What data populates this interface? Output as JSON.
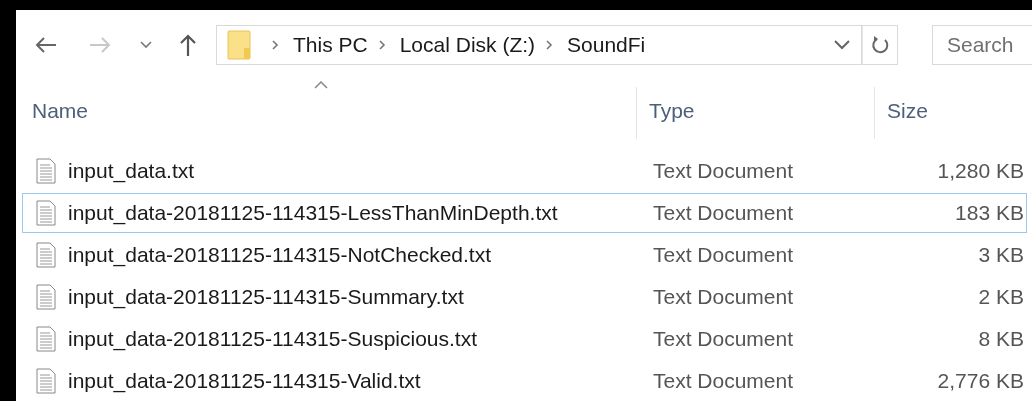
{
  "address_bar": {
    "segments": [
      "This PC",
      "Local Disk (Z:)",
      "SoundFi"
    ]
  },
  "search": {
    "placeholder": "Search"
  },
  "columns": [
    {
      "label": "Name",
      "sorted": true
    },
    {
      "label": "Type",
      "sorted": false
    },
    {
      "label": "Size",
      "sorted": false
    }
  ],
  "rows": [
    {
      "name": "input_data.txt",
      "type": "Text Document",
      "size": "1,280 KB",
      "focused": false
    },
    {
      "name": "input_data-20181125-114315-LessThanMinDepth.txt",
      "type": "Text Document",
      "size": "183 KB",
      "focused": true
    },
    {
      "name": "input_data-20181125-114315-NotChecked.txt",
      "type": "Text Document",
      "size": "3 KB",
      "focused": false
    },
    {
      "name": "input_data-20181125-114315-Summary.txt",
      "type": "Text Document",
      "size": "2 KB",
      "focused": false
    },
    {
      "name": "input_data-20181125-114315-Suspicious.txt",
      "type": "Text Document",
      "size": "8 KB",
      "focused": false
    },
    {
      "name": "input_data-20181125-114315-Valid.txt",
      "type": "Text Document",
      "size": "2,776 KB",
      "focused": false
    }
  ]
}
